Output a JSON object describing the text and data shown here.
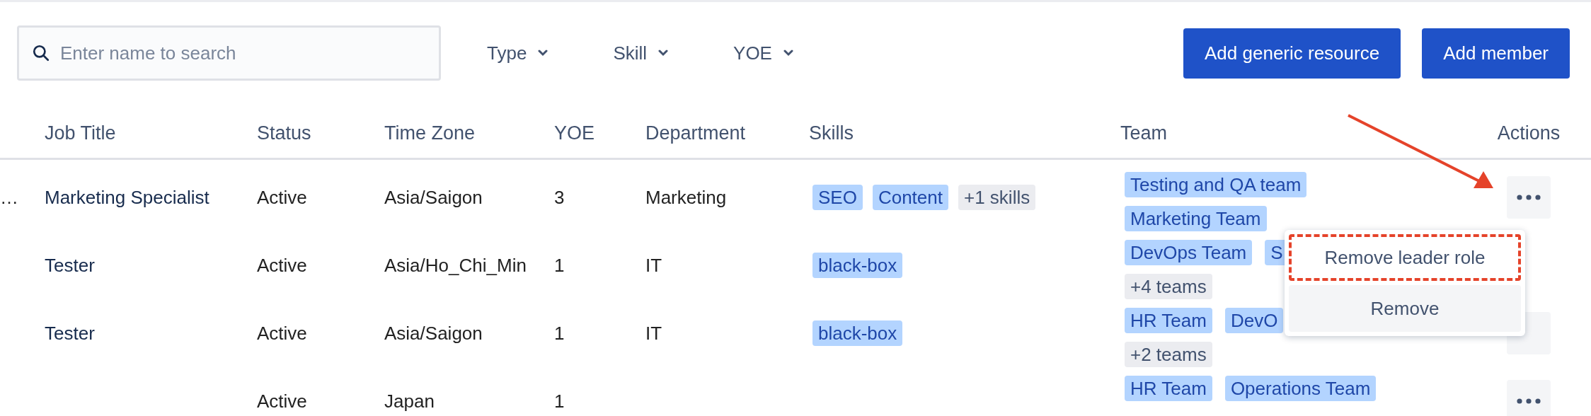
{
  "toolbar": {
    "search": {
      "placeholder": "Enter name to search"
    },
    "filters": [
      "Type",
      "Skill",
      "YOE"
    ],
    "buttons": [
      "Add generic resource",
      "Add member"
    ]
  },
  "table": {
    "columns": [
      "Job Title",
      "Status",
      "Time Zone",
      "YOE",
      "Department",
      "Skills",
      "Team",
      "Actions"
    ],
    "rows": [
      {
        "column_0": "…",
        "job_title": "Marketing Specialist",
        "status": "Active",
        "time_zone": "Asia/Saigon",
        "yoe": "3",
        "department": "Marketing",
        "skills": [
          {
            "label": "SEO",
            "kind": "tag"
          },
          {
            "label": "Content",
            "kind": "tag"
          },
          {
            "label": "+1 skills",
            "kind": "more"
          }
        ],
        "team_lines": [
          [
            {
              "label": "Testing and QA team",
              "kind": "tag"
            }
          ],
          [
            {
              "label": "Marketing Team",
              "kind": "tag"
            }
          ]
        ],
        "action_button": {
          "kind": "full"
        }
      },
      {
        "job_title": "Tester",
        "status": "Active",
        "time_zone": "Asia/Ho_Chi_Min",
        "yoe": "1",
        "department": "IT",
        "skills": [
          {
            "label": "black-box",
            "kind": "tag"
          }
        ],
        "team_lines": [
          [
            {
              "label": "DevOps Team",
              "kind": "tag"
            },
            {
              "label": "S",
              "kind": "tag"
            }
          ],
          [
            {
              "label": "+4 teams",
              "kind": "more"
            }
          ]
        ],
        "action_button": null
      },
      {
        "job_title": "Tester",
        "status": "Active",
        "time_zone": "Asia/Saigon",
        "yoe": "1",
        "department": "IT",
        "skills": [
          {
            "label": "black-box",
            "kind": "tag"
          }
        ],
        "team_lines": [
          [
            {
              "label": "HR Team",
              "kind": "tag"
            },
            {
              "label": "DevO",
              "kind": "tag"
            }
          ],
          [
            {
              "label": "+2 teams",
              "kind": "more"
            }
          ]
        ],
        "action_button": {
          "kind": "covered"
        }
      },
      {
        "job_title": "",
        "status": "Active",
        "time_zone": "Japan",
        "yoe": "1",
        "department": "",
        "skills": [],
        "team_lines": [
          [
            {
              "label": "HR Team",
              "kind": "tag"
            },
            {
              "label": "Operations Team",
              "kind": "tag"
            }
          ]
        ],
        "action_button": {
          "kind": "full"
        }
      }
    ]
  },
  "action_menu": {
    "items": [
      {
        "label": "Remove leader role",
        "highlighted": true
      },
      {
        "label": "Remove",
        "highlighted": false
      }
    ]
  }
}
